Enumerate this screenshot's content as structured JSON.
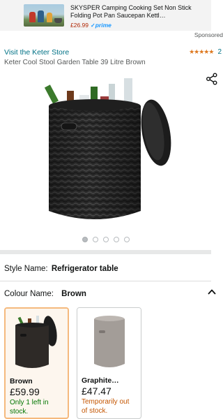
{
  "ad": {
    "title": "SKYSPER Camping Cooking Set Non Stick Folding Pot Pan Saucepan Kettl…",
    "price": "£26.99",
    "prime_check": "✓",
    "prime_label": "prime",
    "sponsored_label": "Sponsored"
  },
  "product": {
    "store_link": "Visit the Keter Store",
    "stars": "★★★★★",
    "rating_count": "2",
    "title": "Keter Cool Stool Garden Table 39 Litre Brown"
  },
  "gallery": {
    "image_count": 5,
    "active_index": 0
  },
  "style": {
    "label": "Style Name:",
    "value": "Refrigerator table"
  },
  "colour": {
    "label": "Colour Name:",
    "value": "Brown"
  },
  "swatches": [
    {
      "name": "Brown",
      "price": "£59.99",
      "availability": "Only 1 left in stock.",
      "availability_color": "#007600",
      "selected": true
    },
    {
      "name": "Graphite…",
      "price": "£47.47",
      "availability": "Temporarily out of stock.",
      "availability_color": "#c45500",
      "selected": false
    }
  ],
  "colors": {
    "link": "#007185",
    "star": "#de7921",
    "price_red": "#b12704",
    "prime_blue": "#1a98ff",
    "selected_border": "#f5b97d"
  },
  "icons": [
    "share-icon",
    "chevron-up-icon",
    "star-icon"
  ]
}
